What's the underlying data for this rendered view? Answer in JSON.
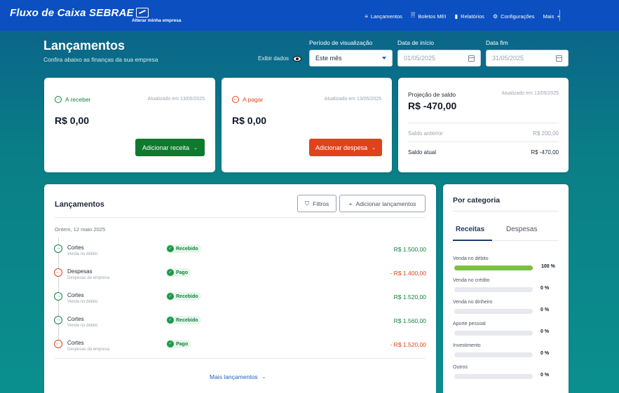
{
  "topbar": {
    "brand": "Fluxo de Caixa SEBRAE",
    "company_link": "Alterar minha empresa",
    "nav": [
      {
        "icon": "list-icon",
        "glyph": "≡",
        "label": "Lançamentos"
      },
      {
        "icon": "document-icon",
        "glyph": "🗎",
        "label": "Boletos MEI"
      },
      {
        "icon": "bar-chart-icon",
        "glyph": "▮",
        "label": "Relatórios"
      },
      {
        "icon": "gear-icon",
        "glyph": "⚙",
        "label": "Configurações"
      },
      {
        "icon": "plus-icon",
        "glyph": "+",
        "label": "Mais"
      }
    ]
  },
  "header": {
    "title": "Lançamentos",
    "subtitle": "Confira abaixo as finanças da sua empresa",
    "show_data": "Exibir dados",
    "period_label": "Período de visualização",
    "period_value": "Este mês",
    "start_label": "Data de início",
    "start_value": "01/05/2025",
    "end_label": "Data fim",
    "end_value": "31/05/2025"
  },
  "receber": {
    "title": "A receber",
    "updated": "Atualizado em 13/05/2025",
    "amount": "R$ 0,00",
    "button": "Adicionar receita"
  },
  "pagar": {
    "title": "A pagar",
    "updated": "Atualizado em 13/05/2025",
    "amount": "R$ 0,00",
    "button": "Adicionar despesa"
  },
  "projecao": {
    "title": "Projeção de saldo",
    "updated": "Atualizado em 13/05/2025",
    "amount": "R$ -470,00",
    "saldo_anterior_label": "Saldo anterior",
    "saldo_anterior_value": "R$ 200,00",
    "saldo_atual_label": "Saldo atual",
    "saldo_atual_value": "R$ -470,00"
  },
  "lancamentos": {
    "title": "Lançamentos",
    "filters": "Filtros",
    "add": "Adicionar lançamentos",
    "date_group": "Ontem, 12 maio 2025",
    "entries": [
      {
        "type": "in",
        "name": "Cortes",
        "category": "Venda no débito",
        "status": "Recebido",
        "value": "R$ 1.500,00"
      },
      {
        "type": "out",
        "name": "Despesas",
        "category": "Despesas da empresa",
        "status": "Pago",
        "value": "- R$ 1.400,00"
      },
      {
        "type": "in",
        "name": "Cortes",
        "category": "Venda no débito",
        "status": "Recebido",
        "value": "R$ 1.520,00"
      },
      {
        "type": "in",
        "name": "Cortes",
        "category": "Venda no débito",
        "status": "Recebido",
        "value": "R$ 1.560,00"
      },
      {
        "type": "out",
        "name": "Cortes",
        "category": "Despesas da empresa",
        "status": "Pago",
        "value": "- R$ 1.520,00"
      }
    ],
    "more": "Mais lançamentos"
  },
  "categoria": {
    "title": "Por categoria",
    "tabs": [
      "Receitas",
      "Despesas"
    ],
    "items": [
      {
        "label": "Venda no débito",
        "percent": 100,
        "percent_label": "100 %"
      },
      {
        "label": "Venda no crédito",
        "percent": 0,
        "percent_label": "0 %"
      },
      {
        "label": "Venda no dinheiro",
        "percent": 0,
        "percent_label": "0 %"
      },
      {
        "label": "Aporte pessoal",
        "percent": 0,
        "percent_label": "0 %"
      },
      {
        "label": "Investimento",
        "percent": 0,
        "percent_label": "0 %"
      },
      {
        "label": "Outros",
        "percent": 0,
        "percent_label": "0 %"
      }
    ]
  },
  "colors": {
    "topbar": "#0b4fc1",
    "income": "#15803d",
    "expense": "#e0421b",
    "bar_fill": "#7bc040"
  }
}
